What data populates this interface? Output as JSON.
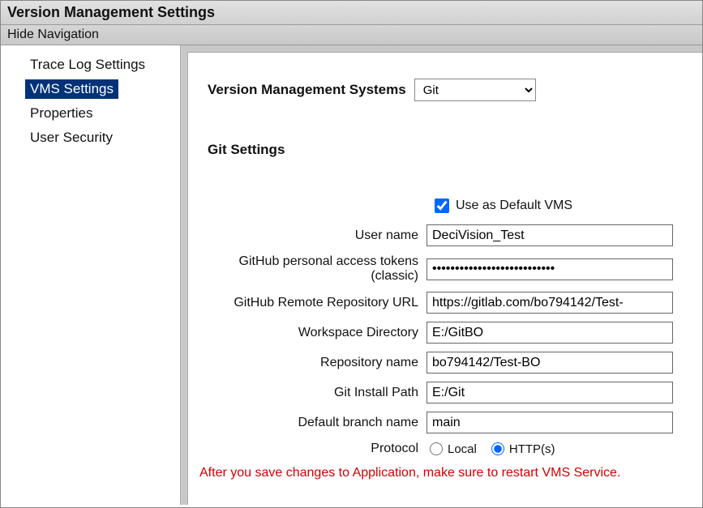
{
  "title": "Version Management Settings",
  "nav": {
    "hide_navigation": "Hide Navigation"
  },
  "sidebar": {
    "items": [
      {
        "label": "Trace Log Settings",
        "selected": false
      },
      {
        "label": "VMS Settings",
        "selected": true
      },
      {
        "label": "Properties",
        "selected": false
      },
      {
        "label": "User Security",
        "selected": false
      }
    ]
  },
  "main": {
    "vms_label": "Version Management Systems",
    "vms_value": "Git",
    "section_title": "Git Settings",
    "default_vms_label": "Use as Default VMS",
    "default_vms_checked": true,
    "fields": {
      "username_label": "User name",
      "username_value": "DeciVision_Test",
      "token_label": "GitHub personal access tokens (classic)",
      "token_value": "•••••••••••••••••••••••••••",
      "repo_url_label": "GitHub Remote Repository URL",
      "repo_url_value": "https://gitlab.com/bo794142/Test-",
      "workspace_label": "Workspace Directory",
      "workspace_value": "E:/GitBO",
      "repo_name_label": "Repository name",
      "repo_name_value": "bo794142/Test-BO",
      "install_path_label": "Git Install Path",
      "install_path_value": "E:/Git",
      "branch_label": "Default branch name",
      "branch_value": "main",
      "protocol_label": "Protocol",
      "protocol_local_label": "Local",
      "protocol_https_label": "HTTP(s)",
      "protocol_selected": "https"
    },
    "warning": "After you save changes to Application, make sure to restart VMS Service."
  }
}
